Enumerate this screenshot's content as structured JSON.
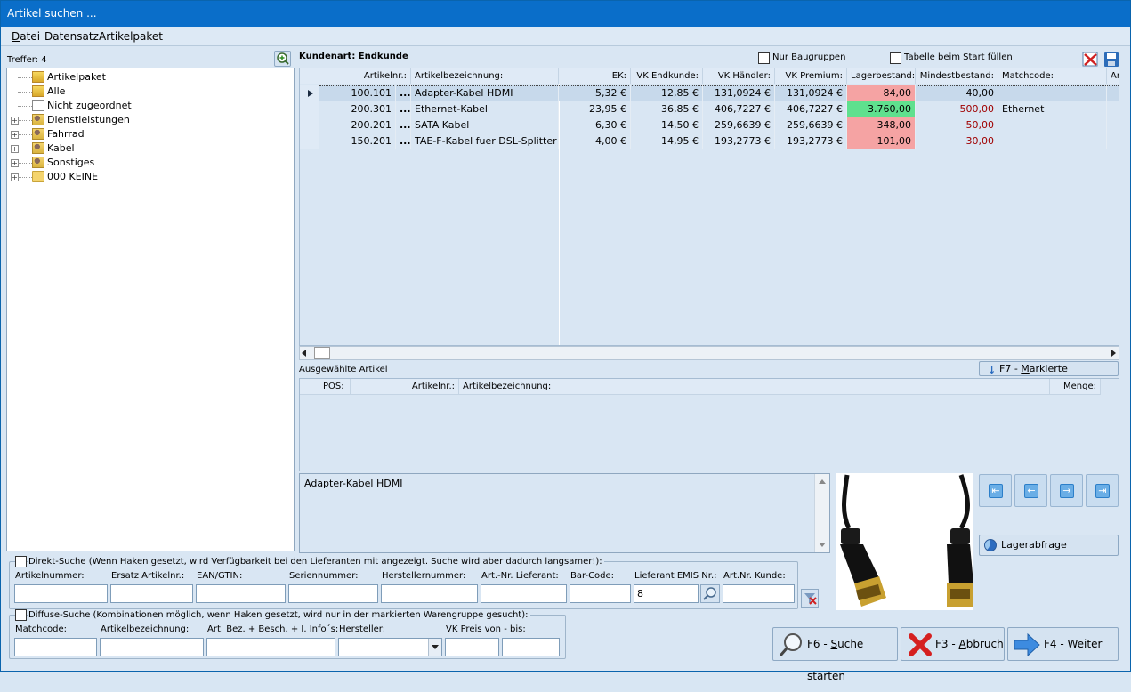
{
  "window": {
    "title": "Artikel suchen ..."
  },
  "menu": {
    "datei": "D",
    "datei_rest": "atei",
    "datensatz": "Datensatz",
    "artikelpaket": "Artikelpaket"
  },
  "tree": {
    "treffer": "Treffer: 4",
    "nodes": [
      {
        "label": "Artikelpaket",
        "icon": "package-icon",
        "expandable": false
      },
      {
        "label": "Alle",
        "icon": "folder-icon",
        "expandable": false
      },
      {
        "label": "Nicht zugeordnet",
        "icon": "document-icon",
        "expandable": false
      },
      {
        "label": "Dienstleistungen",
        "icon": "group-icon",
        "expandable": true
      },
      {
        "label": "Fahrrad",
        "icon": "group-icon",
        "expandable": true
      },
      {
        "label": "Kabel",
        "icon": "group-icon",
        "expandable": true
      },
      {
        "label": "Sonstiges",
        "icon": "group-icon",
        "expandable": true
      },
      {
        "label": "000 KEINE",
        "icon": "folder-icon",
        "expandable": true
      }
    ]
  },
  "top": {
    "kundenart": "Kundenart: Endkunde",
    "nur_baugruppen": "Nur Baugruppen",
    "tabelle_fuellen": "Tabelle beim Start füllen"
  },
  "grid": {
    "columns": [
      "Artikelnr.:",
      "Artikelbezeichnung:",
      "EK:",
      "VK Endkunde:",
      "VK Händler:",
      "VK Premium:",
      "Lagerbestand:",
      "Mindestbestand:",
      "Matchcode:",
      "Ar"
    ],
    "rows": [
      {
        "nr": "100.101",
        "dots": "...",
        "bez": "Adapter-Kabel HDMI",
        "ek": "5,32 €",
        "vke": "12,85 €",
        "vkh": "131,0924 €",
        "vkp": "131,0924 €",
        "lager": "84,00",
        "mind": "40,00",
        "match": ""
      },
      {
        "nr": "200.301",
        "dots": "...",
        "bez": "Ethernet-Kabel",
        "ek": "23,95 €",
        "vke": "36,85 €",
        "vkh": "406,7227 €",
        "vkp": "406,7227 €",
        "lager": "3.760,00",
        "mind": "500,00",
        "match": "Ethernet"
      },
      {
        "nr": "200.201",
        "dots": "...",
        "bez": "SATA Kabel",
        "ek": "6,30 €",
        "vke": "14,50 €",
        "vkh": "259,6639 €",
        "vkp": "259,6639 €",
        "lager": "348,00",
        "mind": "50,00",
        "match": ""
      },
      {
        "nr": "150.201",
        "dots": "...",
        "bez": "TAE-F-Kabel fuer DSL-Splitter",
        "ek": "4,00 €",
        "vke": "14,95 €",
        "vkh": "193,2773 €",
        "vkp": "193,2773 €",
        "lager": "101,00",
        "mind": "30,00",
        "match": ""
      }
    ],
    "colors": {
      "low": "#f5a3a3",
      "ok": "#5fe08e",
      "mind_red": "#a00000"
    }
  },
  "selected": {
    "title": "Ausgewählte Artikel",
    "f7_prefix": "F7 - ",
    "f7_m": "M",
    "f7_rest": "arkierte",
    "columns": [
      "POS:",
      "Artikelnr.:",
      "Artikelbezeichnung:",
      "Menge:"
    ]
  },
  "description": "Adapter-Kabel HDMI",
  "lagerabfrage": "Lagerabfrage",
  "direkt": {
    "title": "Direkt-Suche (Wenn Haken gesetzt, wird Verfügbarkeit bei den Lieferanten mit angezeigt. Suche wird aber dadurch langsamer!):",
    "labels": [
      "Artikelnummer:",
      "Ersatz Artikelnr.:",
      "EAN/GTIN:",
      "Seriennummer:",
      "Herstellernummer:",
      "Art.-Nr. Lieferant:",
      "Bar-Code:",
      "Lieferant EMIS Nr.:",
      "Art.Nr. Kunde:"
    ],
    "lieferant_value": "8"
  },
  "diffuse": {
    "title": "Diffuse-Suche (Kombinationen möglich, wenn Haken gesetzt, wird nur in der markierten Warengruppe gesucht):",
    "labels": [
      "Matchcode:",
      "Artikelbezeichnung:",
      "Art. Bez. + Besch. + I. Info´s:",
      "Hersteller:",
      "VK Preis von - bis:"
    ]
  },
  "buttons": {
    "f6_prefix": "F6 - ",
    "f6_s": "S",
    "f6_rest": "uche starten",
    "f3_prefix": "F3 - ",
    "f3_a": "A",
    "f3_rest": "bbruch",
    "f4": "F4 - Weiter"
  }
}
